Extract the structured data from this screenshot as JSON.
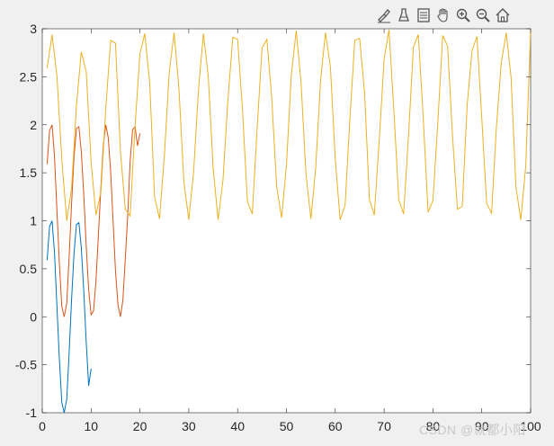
{
  "toolbar": [
    {
      "name": "brush-icon"
    },
    {
      "name": "data-cursor-icon"
    },
    {
      "name": "legend-icon"
    },
    {
      "name": "pan-hand-icon"
    },
    {
      "name": "zoom-in-icon"
    },
    {
      "name": "zoom-out-icon"
    },
    {
      "name": "home-icon"
    }
  ],
  "watermark": "CSDN @就都小阳",
  "chart_data": {
    "type": "line",
    "title": "",
    "xlabel": "",
    "ylabel": "",
    "xlim": [
      0,
      100
    ],
    "ylim": [
      -1,
      3
    ],
    "xticks": [
      "0",
      "10",
      "20",
      "30",
      "40",
      "50",
      "60",
      "70",
      "80",
      "90",
      "100"
    ],
    "yticks": [
      "-1",
      "-0.5",
      "0",
      "0.5",
      "1",
      "1.5",
      "2",
      "2.5",
      "3"
    ],
    "grid": false,
    "series": [
      {
        "color": "#0072BD",
        "x": [
          1,
          1.5,
          2,
          2.5,
          3,
          3.5,
          4,
          4.5,
          5,
          5.5,
          6,
          6.5,
          7,
          7.5,
          8,
          8.5,
          9,
          9.5,
          10
        ],
        "y": [
          0.59,
          0.94,
          1.0,
          0.67,
          0.11,
          -0.44,
          -0.89,
          -1.0,
          -0.86,
          -0.37,
          0.18,
          0.66,
          0.96,
          0.98,
          0.72,
          0.26,
          -0.27,
          -0.72,
          -0.54
        ]
      },
      {
        "color": "#D95319",
        "x": [
          1,
          1.5,
          2,
          2.5,
          3,
          3.5,
          4,
          4.5,
          5,
          5.5,
          6,
          6.5,
          7,
          7.5,
          8,
          8.5,
          9,
          9.5,
          10,
          10.5,
          11,
          11.5,
          12,
          12.5,
          13,
          13.5,
          14,
          14.5,
          15,
          15.5,
          16,
          16.5,
          17,
          17.5,
          18,
          18.5,
          19,
          19.5,
          20
        ],
        "y": [
          1.59,
          1.94,
          2.0,
          1.67,
          1.11,
          0.56,
          0.11,
          0.0,
          0.14,
          0.63,
          1.18,
          1.66,
          1.96,
          1.98,
          1.72,
          1.26,
          0.73,
          0.28,
          0.02,
          0.06,
          0.37,
          0.85,
          1.35,
          1.79,
          2.0,
          1.87,
          1.52,
          1.0,
          0.48,
          0.12,
          0.0,
          0.17,
          0.6,
          1.05,
          1.62,
          1.95,
          1.98,
          1.78,
          1.91
        ]
      },
      {
        "color": "#EDB120",
        "x": [
          1,
          2,
          3,
          4,
          5,
          6,
          7,
          8,
          9,
          10,
          11,
          12,
          13,
          14,
          15,
          16,
          17,
          18,
          19,
          20,
          21,
          22,
          23,
          24,
          25,
          26,
          27,
          28,
          29,
          30,
          31,
          32,
          33,
          34,
          35,
          36,
          37,
          38,
          39,
          40,
          41,
          42,
          43,
          44,
          45,
          46,
          47,
          48,
          49,
          50,
          51,
          52,
          53,
          54,
          55,
          56,
          57,
          58,
          59,
          60,
          61,
          62,
          63,
          64,
          65,
          66,
          67,
          68,
          69,
          70,
          71,
          72,
          73,
          74,
          75,
          76,
          77,
          78,
          79,
          80,
          81,
          82,
          83,
          84,
          85,
          86,
          87,
          88,
          89,
          90,
          91,
          92,
          93,
          94,
          95,
          96,
          97,
          98,
          99,
          100
        ],
        "y": [
          2.59,
          2.94,
          2.51,
          1.64,
          1.0,
          1.34,
          2.2,
          2.76,
          2.55,
          1.61,
          1.06,
          1.3,
          2.17,
          2.88,
          2.85,
          1.73,
          1.12,
          1.05,
          1.99,
          2.74,
          2.95,
          2.43,
          1.25,
          1.02,
          1.68,
          2.55,
          2.96,
          2.37,
          1.4,
          1.01,
          1.51,
          2.38,
          2.95,
          2.5,
          1.55,
          1.01,
          1.42,
          2.24,
          2.91,
          2.89,
          2.16,
          1.2,
          1.07,
          1.96,
          2.8,
          2.89,
          2.27,
          1.36,
          1.03,
          1.58,
          2.52,
          2.98,
          2.43,
          1.49,
          1.02,
          1.56,
          2.47,
          2.96,
          2.6,
          1.64,
          1.01,
          1.16,
          2.07,
          2.88,
          2.9,
          2.33,
          1.22,
          1.06,
          1.84,
          2.68,
          2.99,
          2.14,
          1.22,
          1.07,
          1.9,
          2.81,
          2.94,
          2.09,
          1.09,
          1.21,
          2.02,
          2.93,
          2.82,
          1.89,
          1.12,
          1.15,
          2.2,
          2.77,
          2.92,
          2.07,
          1.18,
          1.08,
          1.98,
          2.65,
          2.96,
          2.49,
          1.35,
          1.01,
          1.57,
          2.99
        ]
      }
    ]
  }
}
